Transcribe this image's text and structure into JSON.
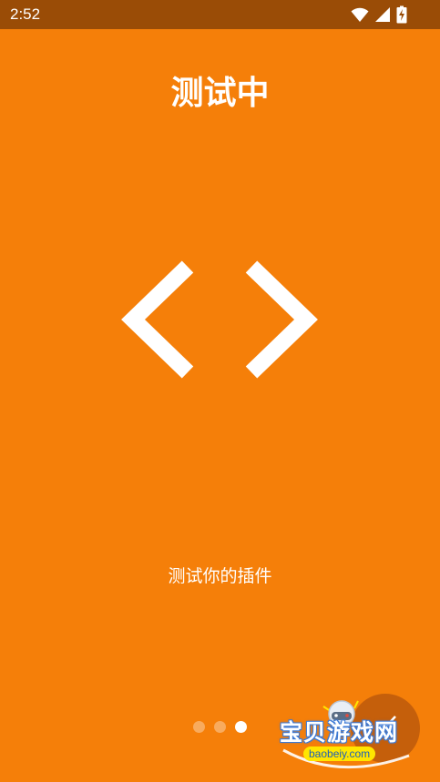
{
  "status_bar": {
    "time": "2:52",
    "icons": [
      "wifi-icon",
      "cellular-signal-icon",
      "battery-charging-icon"
    ]
  },
  "page": {
    "title": "测试中",
    "hero_icon": "code-brackets-icon",
    "subtitle": "测试你的插件"
  },
  "pager": {
    "total": 3,
    "active_index": 2
  },
  "watermark": {
    "name": "宝贝游戏网",
    "url": "baobeiy.com"
  },
  "colors": {
    "background": "#f57f09",
    "status_bar": "#9a4c06",
    "foreground": "#ffffff",
    "watermark_url_bg": "#ffe600"
  }
}
